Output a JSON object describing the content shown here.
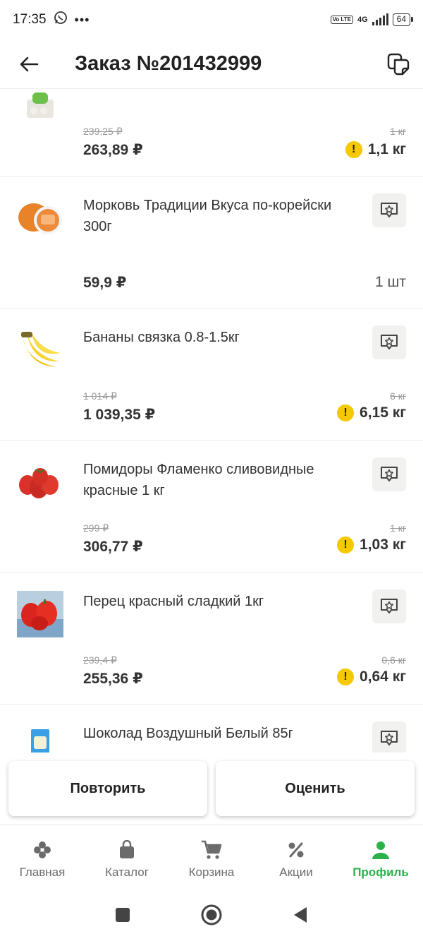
{
  "status_bar": {
    "time": "17:35",
    "network": "4G",
    "volte": "Vo LTE",
    "battery": "64"
  },
  "header": {
    "title": "Заказ №201432999"
  },
  "items": [
    {
      "name": "",
      "old_price": "239,25 ₽",
      "price": "263,89 ₽",
      "old_qty": "1 кг",
      "qty": "1,1 кг"
    },
    {
      "name": "Морковь Традиции Вкуса по-корейски 300г",
      "price": "59,9 ₽",
      "qty": "1 шт"
    },
    {
      "name": "Бананы связка 0.8-1.5кг",
      "old_price": "1 014 ₽",
      "price": "1 039,35 ₽",
      "old_qty": "6 кг",
      "qty": "6,15 кг"
    },
    {
      "name": "Помидоры Фламенко сливовидные красные 1 кг",
      "old_price": "299 ₽",
      "price": "306,77 ₽",
      "old_qty": "1 кг",
      "qty": "1,03 кг"
    },
    {
      "name": "Перец красный сладкий 1кг",
      "old_price": "239,4 ₽",
      "price": "255,36 ₽",
      "old_qty": "0,6 кг",
      "qty": "0,64 кг"
    },
    {
      "name": "Шоколад Воздушный Белый 85г"
    }
  ],
  "warning_mark": "!",
  "actions": {
    "repeat": "Повторить",
    "rate": "Оценить"
  },
  "bottom_nav": {
    "home": "Главная",
    "catalog": "Каталог",
    "cart": "Корзина",
    "promo": "Акции",
    "profile": "Профиль"
  },
  "colors": {
    "accent_green": "#2bb24a",
    "warning_yellow": "#f5c800"
  }
}
